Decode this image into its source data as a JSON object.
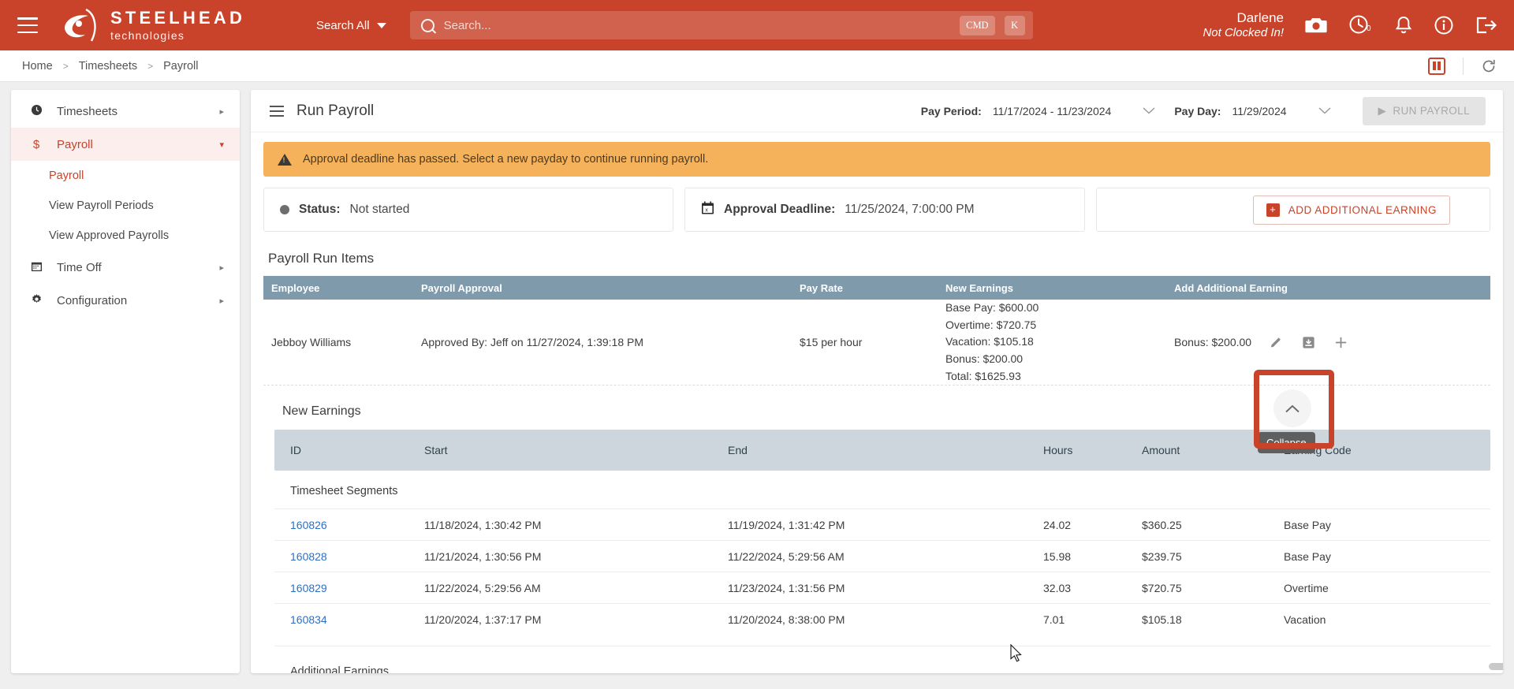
{
  "header": {
    "menu_icon": "hamburger-icon",
    "brand_name": "STEELHEAD",
    "brand_sub": "technologies",
    "search_scope": "Search All",
    "search_placeholder": "Search...",
    "kbd_cmd": "CMD",
    "kbd_key": "K",
    "user_name": "Darlene",
    "user_status": "Not Clocked In!",
    "clock_badge": "0",
    "accent_color": "#c8432a"
  },
  "breadcrumb": {
    "items": [
      "Home",
      "Timesheets",
      "Payroll"
    ],
    "separator": ">"
  },
  "sidebar": {
    "items": [
      {
        "label": "Timesheets",
        "icon": "clock-icon",
        "arrow": "▸",
        "active": false
      },
      {
        "label": "Payroll",
        "icon": "dollar-icon",
        "arrow": "▾",
        "active": true
      },
      {
        "label": "Time Off",
        "icon": "calendar-icon",
        "arrow": "▸",
        "active": false
      },
      {
        "label": "Configuration",
        "icon": "gear-icon",
        "arrow": "▸",
        "active": false
      }
    ],
    "payroll_sub": [
      {
        "label": "Payroll",
        "selected": true
      },
      {
        "label": "View Payroll Periods",
        "selected": false
      },
      {
        "label": "View Approved Payrolls",
        "selected": false
      }
    ]
  },
  "main": {
    "title": "Run Payroll",
    "pay_period_label": "Pay Period:",
    "pay_period_value": "11/17/2024 - 11/23/2024",
    "pay_day_label": "Pay Day:",
    "pay_day_value": "11/29/2024",
    "run_payroll_button": "RUN PAYROLL",
    "alert_text": "Approval deadline has passed. Select a new payday to continue running payroll.",
    "status_label": "Status:",
    "status_value": "Not started",
    "deadline_label": "Approval Deadline:",
    "deadline_value": "11/25/2024, 7:00:00 PM",
    "add_additional_earning_button": "ADD ADDITIONAL EARNING"
  },
  "payroll_run_items": {
    "section_title": "Payroll Run Items",
    "columns": [
      "Employee",
      "Payroll Approval",
      "Pay Rate",
      "New Earnings",
      "Add Additional Earning"
    ],
    "row": {
      "employee": "Jebboy Williams",
      "approval": "Approved By: Jeff on 11/27/2024, 1:39:18 PM",
      "pay_rate": "$15 per hour",
      "earnings": [
        "Base Pay: $600.00",
        "Overtime: $720.75",
        "Vacation: $105.18",
        "Bonus: $200.00",
        "Total: $1625.93"
      ],
      "additional_earning": "Bonus: $200.00"
    },
    "collapse_tooltip": "Collapse"
  },
  "new_earnings": {
    "section_title": "New Earnings",
    "columns": [
      "ID",
      "Start",
      "End",
      "Hours",
      "Amount",
      "Earning Code"
    ],
    "group_timesheet": "Timesheet Segments",
    "group_additional": "Additional Earnings",
    "rows": [
      {
        "id": "160826",
        "start": "11/18/2024, 1:30:42 PM",
        "end": "11/19/2024, 1:31:42 PM",
        "hours": "24.02",
        "amount": "$360.25",
        "code": "Base Pay"
      },
      {
        "id": "160828",
        "start": "11/21/2024, 1:30:56 PM",
        "end": "11/22/2024, 5:29:56 AM",
        "hours": "15.98",
        "amount": "$239.75",
        "code": "Base Pay"
      },
      {
        "id": "160829",
        "start": "11/22/2024, 5:29:56 AM",
        "end": "11/23/2024, 1:31:56 PM",
        "hours": "32.03",
        "amount": "$720.75",
        "code": "Overtime"
      },
      {
        "id": "160834",
        "start": "11/20/2024, 1:37:17 PM",
        "end": "11/20/2024, 8:38:00 PM",
        "hours": "7.01",
        "amount": "$105.18",
        "code": "Vacation"
      }
    ]
  }
}
